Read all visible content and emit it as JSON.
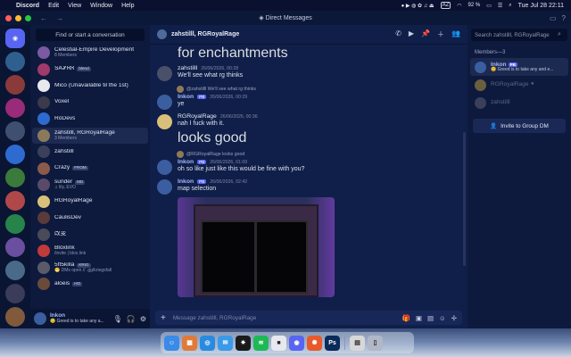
{
  "menubar": {
    "apple": "",
    "app": "Discord",
    "items": [
      "Edit",
      "View",
      "Window",
      "Help"
    ],
    "status": {
      "user_initials": "AZ",
      "battery": "92 %",
      "datetime": "Tue Jul 28  22:11"
    }
  },
  "window": {
    "title": "Direct Messages"
  },
  "servers": [
    {
      "name": "Discord",
      "color": "#5865f2"
    },
    {
      "name": "server-2",
      "color": "#2f5f8f"
    },
    {
      "name": "server-3",
      "color": "#8a3a3a"
    },
    {
      "name": "server-4",
      "color": "#9a2a7a"
    },
    {
      "name": "server-5",
      "color": "#3f4f6f"
    },
    {
      "name": "server-6",
      "color": "#2d6bd1"
    },
    {
      "name": "server-7",
      "color": "#3a7a3a"
    },
    {
      "name": "server-8",
      "color": "#b0484a"
    },
    {
      "name": "server-9",
      "color": "#26844a"
    },
    {
      "name": "server-10",
      "color": "#6a4fa0"
    },
    {
      "name": "server-11",
      "color": "#4a6a8a"
    },
    {
      "name": "server-12",
      "color": "#3b3b5a"
    },
    {
      "name": "server-13",
      "color": "#805a3a"
    },
    {
      "name": "server-14",
      "color": "#5a3a7a"
    },
    {
      "name": "server-15",
      "color": "#3a6a9a"
    }
  ],
  "dm_panel": {
    "find": "Find or start a conversation",
    "items": [
      {
        "name": "Celestial-Empire Development",
        "sub": "8 Members",
        "color": "#7a5aa0",
        "active": false,
        "tag": ""
      },
      {
        "name": "ՏᎪᎽᏒᏒ",
        "sub": "",
        "color": "#a03a6a",
        "active": false,
        "tag": "blend"
      },
      {
        "name": "Mico (Unavailable til the 1st)",
        "sub": "",
        "color": "#e8e8ef",
        "active": false,
        "tag": ""
      },
      {
        "name": "Voxel",
        "sub": "",
        "color": "#3a3a4a",
        "active": false,
        "tag": ""
      },
      {
        "name": "RoDevs",
        "sub": "",
        "color": "#2d6bd1",
        "active": false,
        "tag": ""
      },
      {
        "name": "zahstilll, RGRoyalRage",
        "sub": "3 Members",
        "color": "#8a7a5a",
        "active": true,
        "tag": ""
      },
      {
        "name": "zahstilll",
        "sub": "",
        "color": "#3a3f5a",
        "active": false,
        "tag": ""
      },
      {
        "name": "Crazy",
        "sub": "",
        "color": "#8a5a4a",
        "active": false,
        "tag": "FROM"
      },
      {
        "name": "sunder",
        "sub": "♫ lily, EVO",
        "color": "#5a4a6a",
        "active": false,
        "tag": "MD"
      },
      {
        "name": "RGRoyalRage",
        "sub": "",
        "color": "#d8c07a",
        "active": false,
        "tag": ""
      },
      {
        "name": "CaulisDev",
        "sub": "",
        "color": "#5a3a3a",
        "active": false,
        "tag": ""
      },
      {
        "name": "改变",
        "sub": "",
        "color": "#4a4a5a",
        "active": false,
        "tag": ""
      },
      {
        "name": "Bloxlink",
        "sub": "/invite | blox.link",
        "color": "#c03a3a",
        "active": false,
        "tag": ""
      },
      {
        "name": "5ft5killa",
        "sub": "😁 DMs open // .gg/kriegsfall",
        "color": "#5a5a6a",
        "active": false,
        "tag": "KRIG"
      },
      {
        "name": "aloeis",
        "sub": "",
        "color": "#6a4a3a",
        "active": false,
        "tag": "HO"
      }
    ]
  },
  "user": {
    "name": "Inkon",
    "status": "😊 Greed is to take any a..."
  },
  "chat": {
    "header": "zahstilll, RGRoyalRage",
    "messages": [
      {
        "kind": "cont",
        "text": "for enchantments"
      },
      {
        "kind": "msg",
        "who": "zahstilll",
        "ts": "26/06/2026, 00:28",
        "text": "We'll see what rg thinks",
        "color": "#4a4f6a",
        "blue": false,
        "pb": false
      },
      {
        "kind": "reply",
        "text": "@zahstilll We'll see what rg thinks"
      },
      {
        "kind": "msg",
        "who": "Inkon",
        "ts": "26/06/2026, 00:29",
        "text": "ye",
        "color": "#3a5ea0",
        "blue": true,
        "pb": true
      },
      {
        "kind": "msg",
        "who": "RGRoyalRage",
        "ts": "26/06/2026, 00:36",
        "text": "nah I fuck with it.",
        "color": "#d8c07a",
        "blue": false,
        "pb": false
      },
      {
        "kind": "cont",
        "text": "looks good"
      },
      {
        "kind": "reply",
        "text": "@RGRoyalRage looks good"
      },
      {
        "kind": "msg",
        "who": "Inkon",
        "ts": "26/06/2026, 01:09",
        "text": "oh so like just like this would be fine with you?",
        "color": "#3a5ea0",
        "blue": true,
        "pb": true
      },
      {
        "kind": "msg",
        "who": "Inkon",
        "ts": "26/06/2026, 02:42",
        "text": "map selection",
        "color": "#3a5ea0",
        "blue": true,
        "pb": true
      }
    ],
    "pb_label": "PB",
    "composer_placeholder": "Message zahstilll, RGRoyalRage"
  },
  "members": {
    "search_placeholder": "Search zahstilll, RGRoyalRage",
    "heading": "Members—3",
    "list": [
      {
        "name": "Inkon",
        "status": "😊 Greed is to take any and e...",
        "color": "#3a5ea0",
        "style": "blue",
        "tag": "PB",
        "active": true
      },
      {
        "name": "RGRoyalRage",
        "status": "",
        "color": "#6a6040",
        "style": "dim",
        "tag": "★",
        "active": false
      },
      {
        "name": "zahstilll",
        "status": "",
        "color": "#3a3f5a",
        "style": "dim",
        "tag": "",
        "active": false
      }
    ],
    "invite": "Invite to Group DM"
  },
  "dock": [
    {
      "name": "finder",
      "color": "#3a8ae8",
      "glyph": "☺"
    },
    {
      "name": "launchpad",
      "color": "#e07a3a",
      "glyph": "▦"
    },
    {
      "name": "safari",
      "color": "#2a8ae0",
      "glyph": "◎"
    },
    {
      "name": "mail",
      "color": "#3a9ae8",
      "glyph": "✉"
    },
    {
      "name": "chatgpt",
      "color": "#1a1a1a",
      "glyph": "✷"
    },
    {
      "name": "spotify",
      "color": "#1db954",
      "glyph": "≋"
    },
    {
      "name": "roblox",
      "color": "#e8e8ef",
      "glyph": "■"
    },
    {
      "name": "discord",
      "color": "#5865f2",
      "glyph": "◉"
    },
    {
      "name": "roblox-studio",
      "color": "#e85a2a",
      "glyph": "✺"
    },
    {
      "name": "photoshop",
      "color": "#0a2a5a",
      "glyph": "Ps"
    },
    {
      "name": "documents",
      "color": "#d8d8d8",
      "glyph": "▤"
    },
    {
      "name": "trash",
      "color": "#b0b8c8",
      "glyph": "▯"
    }
  ]
}
